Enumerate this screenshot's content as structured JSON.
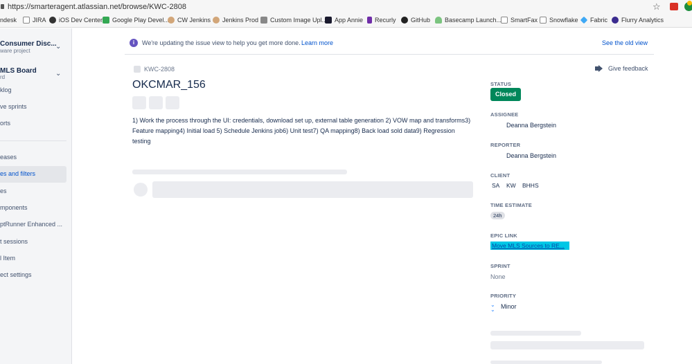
{
  "browser": {
    "url": "https://smarteragent.atlassian.net/browse/KWC-2808"
  },
  "bookmarks": [
    {
      "label": "ndesk",
      "icon": "zendesk-icon",
      "color": "#03363d"
    },
    {
      "label": "JIRA",
      "icon": "page-icon",
      "color": "#ffffff"
    },
    {
      "label": "iOS Dev Center",
      "icon": "apple-icon",
      "color": "#333333"
    },
    {
      "label": "Google Play Devel...",
      "icon": "google-play-icon",
      "color": "#34a853"
    },
    {
      "label": "CW Jenkins",
      "icon": "jenkins-icon",
      "color": "#d2a679"
    },
    {
      "label": "Jenkins Prod",
      "icon": "jenkins-icon",
      "color": "#d2a679"
    },
    {
      "label": "Custom Image Upl...",
      "icon": "image-icon",
      "color": "#888888"
    },
    {
      "label": "App Annie",
      "icon": "app-annie-icon",
      "color": "#1a1a2e"
    },
    {
      "label": "Recurly",
      "icon": "recurly-icon",
      "color": "#6f2da8"
    },
    {
      "label": "GitHub",
      "icon": "github-icon",
      "color": "#222222"
    },
    {
      "label": "Basecamp Launch...",
      "icon": "basecamp-icon",
      "color": "#7bc47f"
    },
    {
      "label": "SmartFax",
      "icon": "page-icon",
      "color": "#ffffff"
    },
    {
      "label": "Snowflake",
      "icon": "page-icon",
      "color": "#ffffff"
    },
    {
      "label": "Fabric",
      "icon": "fabric-icon",
      "color": "#3fa9f5"
    },
    {
      "label": "Flurry Analytics",
      "icon": "flurry-icon",
      "color": "#3b2c8f"
    }
  ],
  "sidebar": {
    "project1": {
      "name": "Consumer Disc...",
      "sub": "ware project"
    },
    "project2": {
      "name": "MLS Board",
      "sub": "rd"
    },
    "items": [
      {
        "label": "klog"
      },
      {
        "label": "ve sprints"
      },
      {
        "label": "orts"
      },
      {
        "label": "eases"
      },
      {
        "label": "es and filters"
      },
      {
        "label": "es"
      },
      {
        "label": "mponents"
      },
      {
        "label": "ptRunner Enhanced ..."
      },
      {
        "label": "t sessions"
      },
      {
        "label": "l Item"
      },
      {
        "label": "ect settings"
      }
    ]
  },
  "banner": {
    "message": "We're updating the issue view to help you get more done.",
    "learn_more": "Learn more",
    "old_view": "See the old view"
  },
  "issue": {
    "key": "KWC-2808",
    "title": "OKCMAR_156",
    "feedback": "Give feedback",
    "description": "1) Work the process through the UI: credentials, download set up, external table generation 2) VOW map and transforms3) Feature mapping4) Initial load 5) Schedule Jenkins job6) Unit test7) QA mapping8) Back load sold data9) Regression testing"
  },
  "details": {
    "status_label": "STATUS",
    "status": "Closed",
    "assignee_label": "ASSIGNEE",
    "assignee": "Deanna Bergstein",
    "reporter_label": "REPORTER",
    "reporter": "Deanna Bergstein",
    "client_label": "CLIENT",
    "clients": [
      "SA",
      "KW",
      "BHHS"
    ],
    "estimate_label": "TIME ESTIMATE",
    "estimate": "24h",
    "epic_label": "EPIC LINK",
    "epic": "Move MLS Sources to RE...",
    "sprint_label": "SPRINT",
    "sprint": "None",
    "priority_label": "PRIORITY",
    "priority": "Minor"
  },
  "colors": {
    "status_closed": "#00875a",
    "epic_bg": "#00c7e6",
    "link": "#0052cc",
    "info": "#6554c0"
  }
}
